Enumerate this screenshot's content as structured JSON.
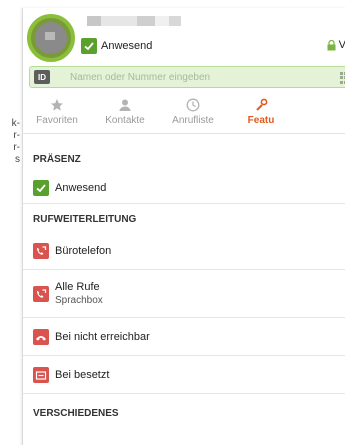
{
  "background_page": {
    "lines": [
      "k-",
      "r-",
      "r-",
      "s"
    ]
  },
  "header": {
    "presence_label": "Anwesend",
    "lock_text": "V"
  },
  "search": {
    "badge": "ID",
    "placeholder": "Namen oder Nummer eingeben"
  },
  "tabs": [
    {
      "label": "Favoriten",
      "icon": "star-icon"
    },
    {
      "label": "Kontakte",
      "icon": "person-icon"
    },
    {
      "label": "Anrufliste",
      "icon": "clock-icon"
    },
    {
      "label": "Featu",
      "icon": "wrench-icon",
      "active": true
    }
  ],
  "sections": {
    "presence": {
      "title": "PRÄSENZ",
      "items": [
        {
          "label": "Anwesend",
          "icon": "check-icon"
        }
      ]
    },
    "forwarding": {
      "title": "RUFWEITERLEITUNG",
      "items": [
        {
          "label": "Bürotelefon",
          "icon": "phone-forward-icon"
        },
        {
          "label": "Alle Rufe",
          "sublabel": "Sprachbox",
          "icon": "phone-forward-icon"
        },
        {
          "label": "Bei nicht erreichbar",
          "icon": "unreachable-icon"
        },
        {
          "label": "Bei besetzt",
          "icon": "busy-icon"
        }
      ]
    },
    "misc": {
      "title": "VERSCHIEDENES"
    }
  },
  "colors": {
    "accent_green": "#5aa02c",
    "search_bg": "#e4f3d8",
    "active_tab": "#e25a1c"
  }
}
